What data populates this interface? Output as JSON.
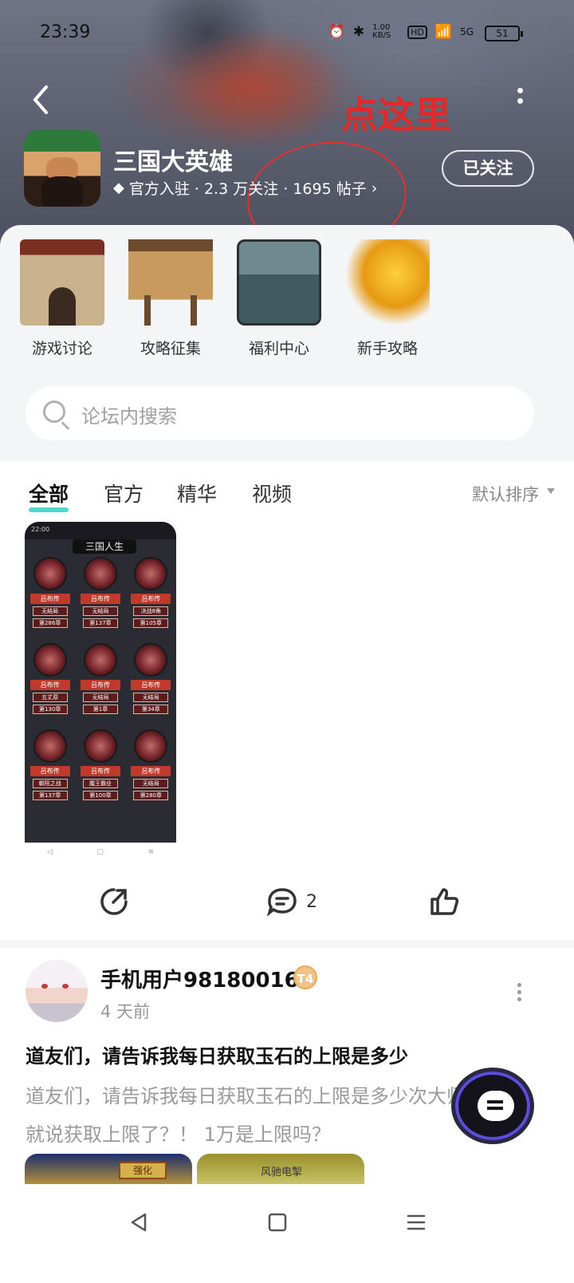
{
  "status_bar": {
    "time": "23:39",
    "net_speed": "1.00 KB/S",
    "hd": "HD",
    "signal": "5G",
    "battery": "51"
  },
  "annotation": {
    "text": "点这里",
    "color": "#e02a2a"
  },
  "header": {
    "game_name": "三国大英雄",
    "meta": "官方入驻 · 2.3 万关注 · 1695 帖子",
    "follow_label": "已关注"
  },
  "shortcuts": [
    {
      "label": "游戏讨论",
      "icon": "city-gate-icon"
    },
    {
      "label": "攻略征集",
      "icon": "notice-board-icon"
    },
    {
      "label": "福利中心",
      "icon": "treasure-chest-icon"
    },
    {
      "label": "新手攻略",
      "icon": "golden-leaf-icon"
    }
  ],
  "search": {
    "placeholder": "论坛内搜索"
  },
  "tabs": {
    "items": [
      "全部",
      "官方",
      "精华",
      "视频"
    ],
    "active": "全部",
    "sort_label": "默认排序",
    "accent": "#3ed4c6"
  },
  "post1": {
    "image": {
      "status_time": "22:00",
      "title": "三国人生",
      "cells": [
        {
          "tag": "吕布传",
          "status": "无结局",
          "chapter": "第286章"
        },
        {
          "tag": "吕布传",
          "status": "无结局",
          "chapter": "第137章"
        },
        {
          "tag": "吕布传",
          "status": "决战8角",
          "chapter": "第105章"
        },
        {
          "tag": "吕布传",
          "status": "五丈原",
          "chapter": "第130章"
        },
        {
          "tag": "吕布传",
          "status": "无结局",
          "chapter": "第1章"
        },
        {
          "tag": "吕布传",
          "status": "无结局",
          "chapter": "第34章"
        },
        {
          "tag": "吕布传",
          "status": "朝阳之战",
          "chapter": "第137章"
        },
        {
          "tag": "吕布传",
          "status": "魔王霸业",
          "chapter": "第100章"
        },
        {
          "tag": "吕布传",
          "status": "无结局",
          "chapter": "第280章"
        }
      ]
    },
    "comment_count": "2"
  },
  "post2": {
    "username": "手机用户98180016",
    "level_badge": "T4",
    "time_ago": "4 天前",
    "title": "道友们，请告诉我每日获取玉石的上限是多少",
    "body": "道友们，请告诉我每日获取玉石的上限是多少次大师就说获取上限了？！ 1万是上限吗？",
    "thumb1_label": "强化",
    "thumb2_label": "风驰电掣"
  }
}
